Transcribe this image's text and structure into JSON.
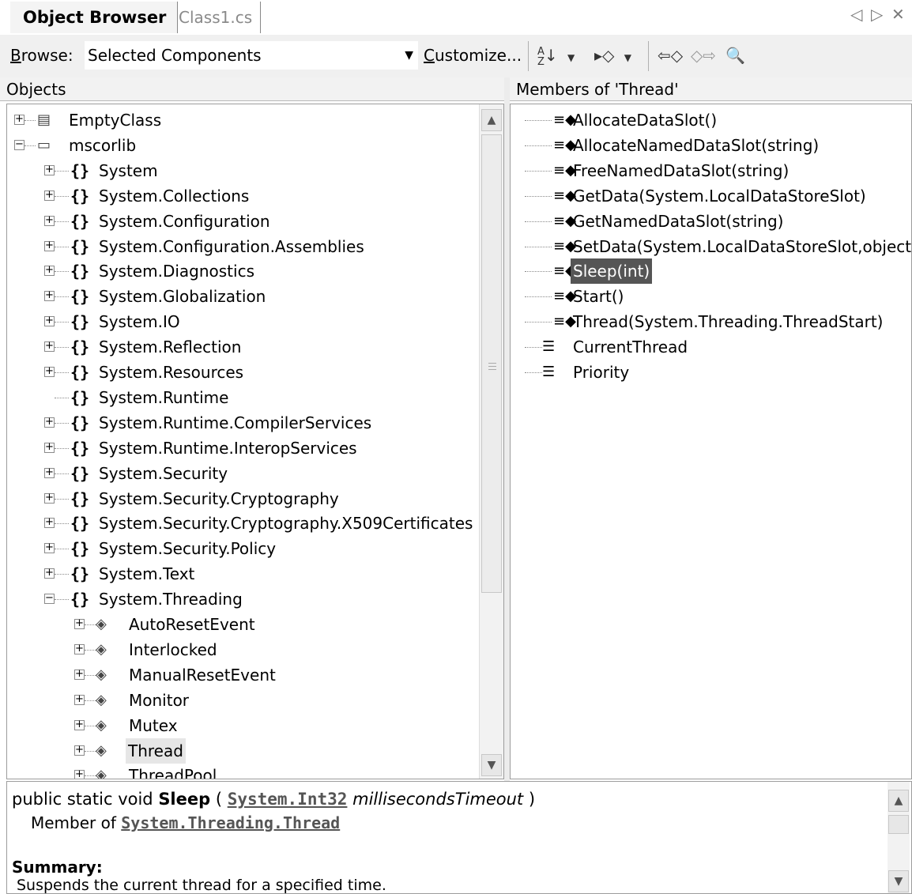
{
  "tabs": {
    "active": "Object Browser",
    "inactive": "Class1.cs",
    "nav_left": "◁",
    "nav_right": "▷",
    "close": "✕"
  },
  "toolbar": {
    "browse_label": "Browse:",
    "browse_value": "Selected Components",
    "customize_label": "Customize...",
    "sort_icon": "sort-alphabetical-icon",
    "group_icon": "group-by-type-icon",
    "back_icon": "navigate-back-icon",
    "forward_icon": "navigate-forward-icon",
    "find_icon": "find-symbol-icon"
  },
  "objects": {
    "header": "Objects",
    "root": [
      {
        "label": "EmptyClass",
        "icon": "project-icon",
        "expanded": false
      },
      {
        "label": "mscorlib",
        "icon": "assembly-icon",
        "expanded": true
      }
    ],
    "namespaces": [
      {
        "label": "System",
        "expander": "+"
      },
      {
        "label": "System.Collections",
        "expander": "+"
      },
      {
        "label": "System.Configuration",
        "expander": "+"
      },
      {
        "label": "System.Configuration.Assemblies",
        "expander": "+"
      },
      {
        "label": "System.Diagnostics",
        "expander": "+"
      },
      {
        "label": "System.Globalization",
        "expander": "+"
      },
      {
        "label": "System.IO",
        "expander": "+"
      },
      {
        "label": "System.Reflection",
        "expander": "+"
      },
      {
        "label": "System.Resources",
        "expander": "+"
      },
      {
        "label": "System.Runtime",
        "expander": ""
      },
      {
        "label": "System.Runtime.CompilerServices",
        "expander": "+"
      },
      {
        "label": "System.Runtime.InteropServices",
        "expander": "+"
      },
      {
        "label": "System.Security",
        "expander": "+"
      },
      {
        "label": "System.Security.Cryptography",
        "expander": "+"
      },
      {
        "label": "System.Security.Cryptography.X509Certificates",
        "expander": "+"
      },
      {
        "label": "System.Security.Policy",
        "expander": "+"
      },
      {
        "label": "System.Text",
        "expander": "+"
      },
      {
        "label": "System.Threading",
        "expander": "−"
      }
    ],
    "classes": [
      {
        "label": "AutoResetEvent"
      },
      {
        "label": "Interlocked"
      },
      {
        "label": "ManualResetEvent"
      },
      {
        "label": "Monitor"
      },
      {
        "label": "Mutex"
      },
      {
        "label": "Thread",
        "selected": true
      },
      {
        "label": "ThreadPool"
      }
    ]
  },
  "members": {
    "header": "Members of 'Thread'",
    "items": [
      {
        "label": "AllocateDataSlot()",
        "kind": "method"
      },
      {
        "label": "AllocateNamedDataSlot(string)",
        "kind": "method"
      },
      {
        "label": "FreeNamedDataSlot(string)",
        "kind": "method"
      },
      {
        "label": "GetData(System.LocalDataStoreSlot)",
        "kind": "method"
      },
      {
        "label": "GetNamedDataSlot(string)",
        "kind": "method"
      },
      {
        "label": "SetData(System.LocalDataStoreSlot,object)",
        "kind": "method"
      },
      {
        "label": "Sleep(int)",
        "kind": "method",
        "selected": true
      },
      {
        "label": "Start()",
        "kind": "method"
      },
      {
        "label": "Thread(System.Threading.ThreadStart)",
        "kind": "method"
      },
      {
        "label": "CurrentThread",
        "kind": "property"
      },
      {
        "label": "Priority",
        "kind": "property"
      }
    ]
  },
  "description": {
    "prefix": "public static void ",
    "method": "Sleep",
    "open": " ( ",
    "param_type": "System.Int32",
    "param_name": "millisecondsTimeout",
    "close": " )",
    "member_of_label": "Member of ",
    "member_of_link": "System.Threading.Thread",
    "summary_label": "Summary:",
    "summary_text": "Suspends the current thread for a specified time."
  },
  "colors": {
    "selection": "#555555",
    "inactive_selection": "#e6e6e6",
    "toolbar_bg": "#f0f0f0"
  }
}
